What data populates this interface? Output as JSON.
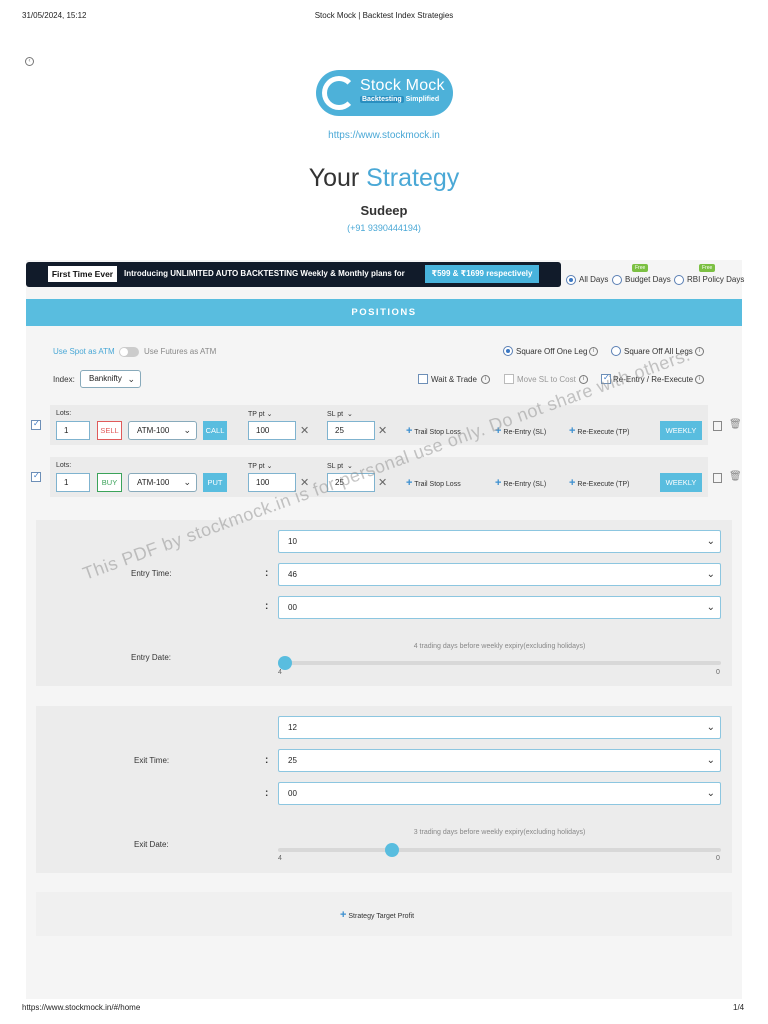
{
  "print_header": {
    "datetime": "31/05/2024, 15:12",
    "title": "Stock Mock | Backtest Index Strategies"
  },
  "print_footer": {
    "url": "https://www.stockmock.in/#/home",
    "page": "1/4"
  },
  "logo": {
    "title": "Stock Mock",
    "sub_highlight": "Backtesting",
    "sub_rest": "Simplified"
  },
  "site_url": "https://www.stockmock.in",
  "heading": {
    "part1": "Your",
    "part2": "Strategy"
  },
  "user": {
    "name": "Sudeep",
    "phone": "(+91 9390444194)"
  },
  "banner": {
    "first": "First Time Ever",
    "intro": "Introducing UNLIMITED AUTO BACKTESTING Weekly & Monthly plans for",
    "price": "₹599 & ₹1699 respectively"
  },
  "day_filters": [
    {
      "label": "All Days",
      "selected": true,
      "badge": ""
    },
    {
      "label": "Budget Days",
      "selected": false,
      "badge": "Free"
    },
    {
      "label": "RBI Policy Days",
      "selected": false,
      "badge": "Free"
    }
  ],
  "positions_title": "POSITIONS",
  "options": {
    "use_spot": "Use Spot as ATM",
    "use_futures": "Use Futures as ATM",
    "square_one": "Square Off One Leg",
    "square_all": "Square Off All Legs",
    "index_label": "Index:",
    "index_value": "Banknifty",
    "wait_trade": "Wait & Trade",
    "move_sl": "Move SL to Cost",
    "reentry": "Re-Entry / Re-Execute"
  },
  "legs": [
    {
      "lots_label": "Lots:",
      "lots": "1",
      "side": "SELL",
      "strike": "ATM-100",
      "type": "CALL",
      "tp_label": "TP pt",
      "tp": "100",
      "sl_label": "SL pt",
      "sl": "25",
      "trail": "Trail Stop Loss",
      "reentry": "Re-Entry (SL)",
      "reexec": "Re-Execute (TP)",
      "expiry": "WEEKLY"
    },
    {
      "lots_label": "Lots:",
      "lots": "1",
      "side": "BUY",
      "strike": "ATM-100",
      "type": "PUT",
      "tp_label": "TP pt",
      "tp": "100",
      "sl_label": "SL pt",
      "sl": "25",
      "trail": "Trail Stop Loss",
      "reentry": "Re-Entry (SL)",
      "reexec": "Re-Execute (TP)",
      "expiry": "WEEKLY"
    }
  ],
  "entry": {
    "time_label": "Entry Time:",
    "hour": "10",
    "minute": "46",
    "second": "00",
    "date_label": "Entry Date:",
    "slider_caption": "4 trading days before weekly expiry(excluding holidays)",
    "slider_min": "4",
    "slider_max": "0",
    "slider_value": 4
  },
  "exit": {
    "time_label": "Exit Time:",
    "hour": "12",
    "minute": "25",
    "second": "00",
    "date_label": "Exit Date:",
    "slider_caption": "3 trading days before weekly expiry(excluding holidays)",
    "slider_min": "4",
    "slider_max": "0",
    "slider_value": 3
  },
  "target_profit": "Strategy Target Profit",
  "watermark": "This PDF by stockmock.in is for personal use only. Do not share with others.",
  "colons": [
    ":",
    ":",
    ":",
    ":",
    ":",
    ":"
  ]
}
